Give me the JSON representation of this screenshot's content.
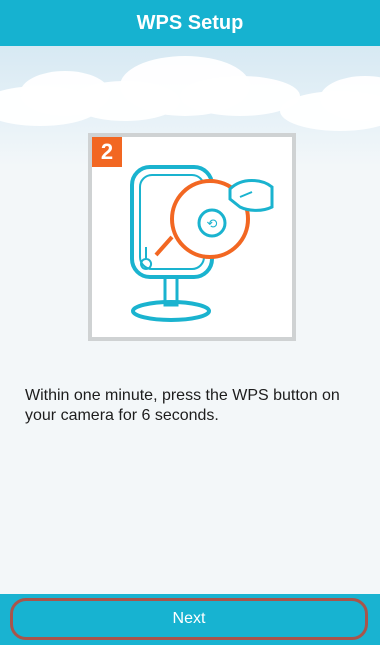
{
  "header": {
    "title": "WPS Setup"
  },
  "illustration": {
    "step_number": "2",
    "icon": "camera-wps-press-icon"
  },
  "instruction": {
    "text": "Within one minute, press the WPS button on your camera for 6 seconds."
  },
  "footer": {
    "next_label": "Next"
  },
  "colors": {
    "header": "#16b2d0",
    "accent_orange": "#f26722",
    "illustration_teal": "#1ab3cf",
    "button_border": "#a8554b"
  }
}
